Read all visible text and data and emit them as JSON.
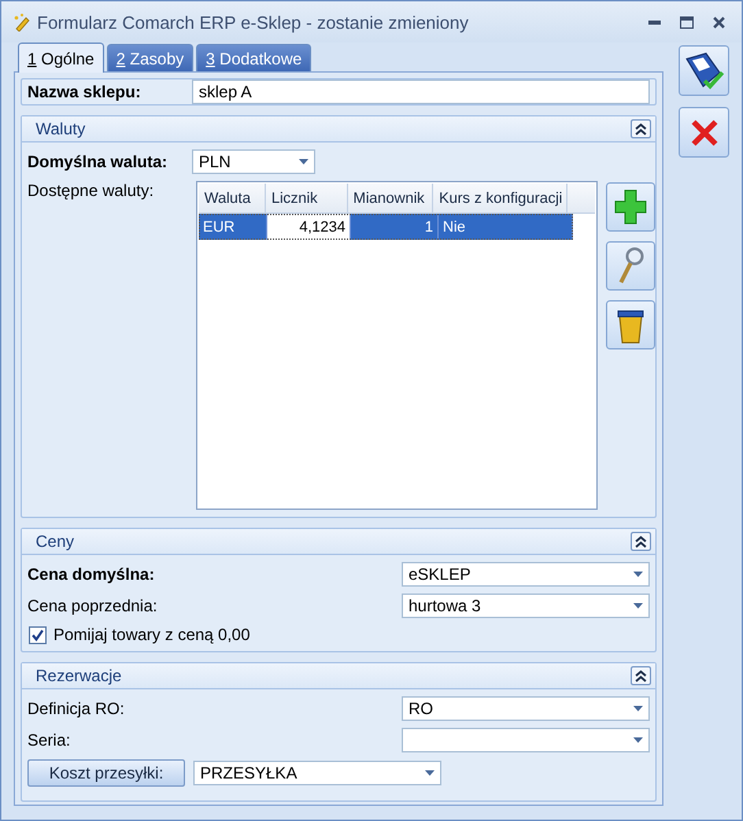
{
  "window": {
    "title": "Formularz Comarch ERP e-Sklep - zostanie zmieniony"
  },
  "tabs": [
    {
      "key": "1",
      "label": "Ogólne",
      "selected": true
    },
    {
      "key": "2",
      "label": "Zasoby",
      "selected": false
    },
    {
      "key": "3",
      "label": "Dodatkowe",
      "selected": false
    }
  ],
  "shop_name": {
    "label": "Nazwa sklepu:",
    "value": "sklep A"
  },
  "currencies": {
    "title": "Waluty",
    "expanded": true,
    "default_label": "Domyślna waluta:",
    "default_value": "PLN",
    "available_label": "Dostępne waluty:",
    "table": {
      "columns": [
        {
          "name": "Waluta",
          "kind": "text"
        },
        {
          "name": "Licznik",
          "kind": "number"
        },
        {
          "name": "Mianownik",
          "kind": "number"
        },
        {
          "name": "Kurs z konfiguracji",
          "kind": "text"
        }
      ],
      "rows": [
        {
          "selected": true,
          "cells": [
            {
              "text": "EUR",
              "focused": false
            },
            {
              "text": "4,1234",
              "focused": true
            },
            {
              "text": "1",
              "focused": false
            },
            {
              "text": "Nie",
              "focused": false
            }
          ]
        }
      ]
    }
  },
  "prices": {
    "title": "Ceny",
    "expanded": true,
    "fields": [
      {
        "label": "Cena domyślna:",
        "value": "eSKLEP",
        "bold": true
      },
      {
        "label": "Cena poprzednia:",
        "value": "hurtowa 3",
        "bold": false
      }
    ],
    "skip_zero": {
      "label": "Pomijaj towary z ceną 0,00",
      "checked": true
    }
  },
  "reservations": {
    "title": "Rezerwacje",
    "expanded": true,
    "fields": [
      {
        "label": "Definicja RO:",
        "value": "RO",
        "bold": false
      },
      {
        "label": "Seria:",
        "bold": false
      }
    ],
    "shipping": {
      "button": "Koszt przesyłki:",
      "value": "PRZESYŁKA"
    }
  }
}
